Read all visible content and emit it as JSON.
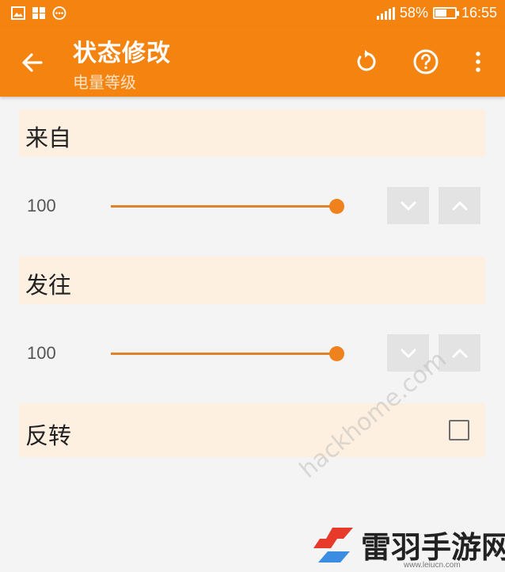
{
  "status_bar": {
    "battery_percent": "58%",
    "battery_level": 0.58,
    "time": "16:55",
    "icons": [
      "image-icon",
      "apps-icon",
      "more-circle-icon",
      "signal-icon",
      "battery-icon"
    ]
  },
  "toolbar": {
    "title": "状态修改",
    "subtitle": "电量等级",
    "icons": [
      "back-arrow-icon",
      "undo-icon",
      "help-icon",
      "more-vert-icon"
    ]
  },
  "sections": {
    "from": {
      "label": "来自",
      "value": "100",
      "slider_fraction": 1.0
    },
    "to": {
      "label": "发往",
      "value": "100",
      "slider_fraction": 1.0
    },
    "invert": {
      "label": "反转",
      "checked": false
    }
  },
  "watermark": {
    "text": "hackhome.com",
    "logo_text": "雷羽手游网",
    "logo_url": "www.leiucn.com"
  },
  "colors": {
    "accent": "#f5830f",
    "section_bg": "#fdf0e1",
    "slider": "#f0821e",
    "button_bg": "#e3e3e3"
  }
}
